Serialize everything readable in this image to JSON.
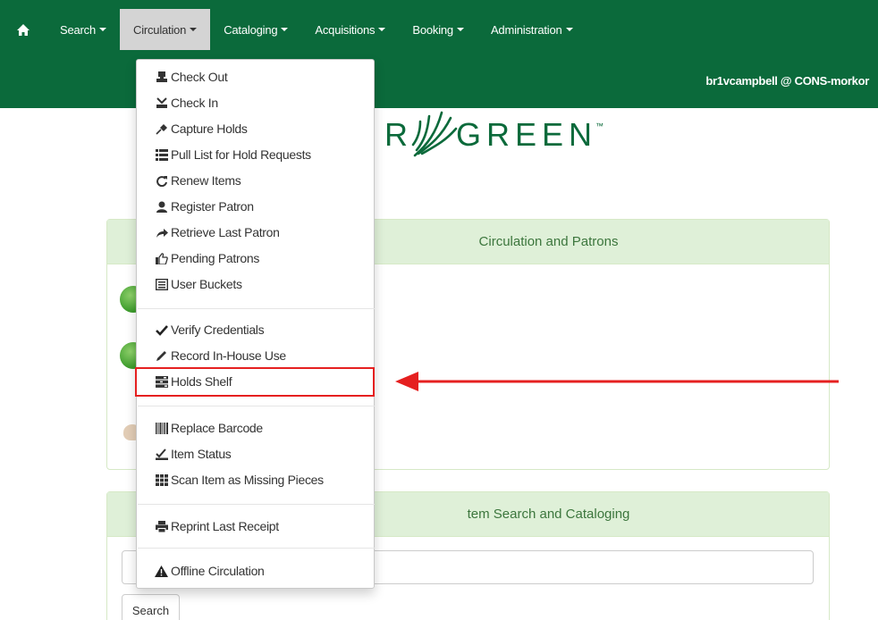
{
  "nav": {
    "home_icon": "home-icon",
    "items": [
      {
        "label": "Search"
      },
      {
        "label": "Circulation"
      },
      {
        "label": "Cataloging"
      },
      {
        "label": "Acquisitions"
      },
      {
        "label": "Booking"
      },
      {
        "label": "Administration"
      }
    ],
    "user": "br1vcampbell @ CONS-morkor",
    "active_color": "#d4d4d4",
    "bar_color": "#0b6a3b"
  },
  "logo": {
    "text": "R GREEN",
    "tm": "™"
  },
  "panels": {
    "circulation_heading": "Circulation and Patrons",
    "item_search_heading": "tem Search and Cataloging"
  },
  "search": {
    "button_label": "Search"
  },
  "menu": {
    "items": [
      {
        "label": "Check Out",
        "icon": "checkout-icon"
      },
      {
        "label": "Check In",
        "icon": "checkin-icon"
      },
      {
        "label": "Capture Holds",
        "icon": "pushpin-icon"
      },
      {
        "label": "Pull List for Hold Requests",
        "icon": "list-icon"
      },
      {
        "label": "Renew Items",
        "icon": "refresh-icon"
      },
      {
        "label": "Register Patron",
        "icon": "user-icon"
      },
      {
        "label": "Retrieve Last Patron",
        "icon": "share-arrow-icon"
      },
      {
        "label": "Pending Patrons",
        "icon": "thumbs-up-icon"
      },
      {
        "label": "User Buckets",
        "icon": "list-alt-icon"
      },
      {
        "label": "Verify Credentials",
        "icon": "ok-icon"
      },
      {
        "label": "Record In-House Use",
        "icon": "pencil-icon"
      },
      {
        "label": "Holds Shelf",
        "icon": "tasks-icon"
      },
      {
        "label": "Replace Barcode",
        "icon": "barcode-icon"
      },
      {
        "label": "Item Status",
        "icon": "status-icon"
      },
      {
        "label": "Scan Item as Missing Pieces",
        "icon": "th-icon"
      },
      {
        "label": "Reprint Last Receipt",
        "icon": "print-icon"
      },
      {
        "label": "Offline Circulation",
        "icon": "alert-icon"
      }
    ],
    "highlighted": "Holds Shelf",
    "highlight_color": "#e52020"
  }
}
